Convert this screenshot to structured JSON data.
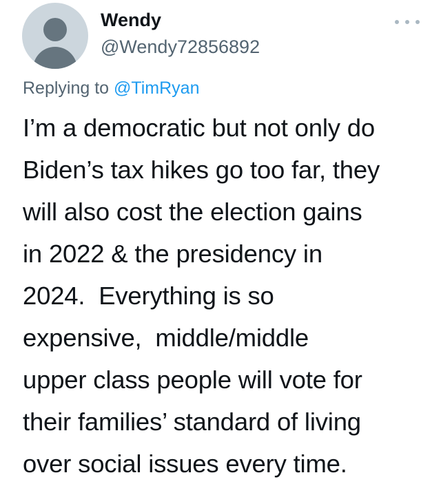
{
  "author": {
    "display_name": "Wendy",
    "handle": "@Wendy72856892",
    "avatar_icon": "default-avatar-icon"
  },
  "menu": {
    "icon": "more-options-icon"
  },
  "reply": {
    "prefix": "Replying to ",
    "mention": "@TimRyan"
  },
  "tweet": {
    "lines": [
      "I’m a democratic but not only do",
      "Biden’s tax hikes go too far, they",
      "will also cost the election gains",
      "in 2022 & the presidency in",
      "2024.  Everything is so",
      "expensive,  middle/middle",
      "upper class people will vote for",
      "their families’ standard of living",
      "over social issues every time."
    ]
  },
  "colors": {
    "text": "#0f1419",
    "secondary": "#536471",
    "link": "#1d9bf0",
    "avatar_bg": "#ccd6dd",
    "avatar_fg": "#66757f"
  }
}
